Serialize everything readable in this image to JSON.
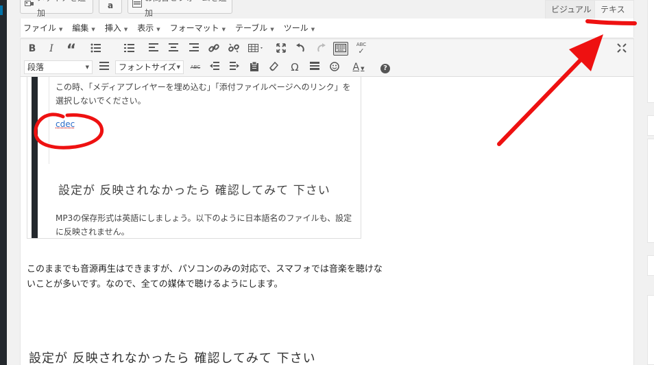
{
  "top_bar": {
    "add_media_label": "メディアを追加",
    "amazon_label": "a",
    "add_contact_form_label": "お問合せフォームを追加",
    "tab_visual": "ビジュアル",
    "tab_text": "テキスト"
  },
  "menubar": {
    "items": [
      {
        "label": "ファイル"
      },
      {
        "label": "編集"
      },
      {
        "label": "挿入"
      },
      {
        "label": "表示"
      },
      {
        "label": "フォーマット"
      },
      {
        "label": "テーブル"
      },
      {
        "label": "ツール"
      }
    ]
  },
  "toolbar": {
    "row1_icons": [
      "bold-icon",
      "italic-icon",
      "blockquote-icon",
      "bullet-list-icon",
      "numbered-list-icon",
      "align-left-icon",
      "align-center-icon",
      "align-right-icon",
      "link-icon",
      "unlink-icon",
      "table-icon",
      "fullscreen-icon",
      "undo-icon",
      "redo-icon",
      "toolbar-toggle-icon",
      "spellcheck-icon",
      "distraction-free-icon"
    ],
    "format_select": "段落",
    "font_size_select": "フォントサイズ",
    "bold": "B",
    "italic": "I",
    "quote": "“",
    "abc": "ABC",
    "omega": "Ω",
    "text_color": "A",
    "help": "?"
  },
  "editor": {
    "embed_text_1": "この時、「メディアプレイヤーを埋め込む」「添付ファイルページへのリンク」を選択しないでください。",
    "embed_link": "cdec",
    "embed_heading": "設定が 反映されなかったら 確認してみて 下さい",
    "embed_text_2": "MP3の保存形式は英語にしましょう。以下のように日本語名のファイルも、設定に反映されません。",
    "paragraph": "このままでも音源再生はできますが、パソコンのみの対応で、スマフォでは音楽を聴けないことが多いです。なので、全ての媒体で聴けるようにします。",
    "heading": "設定が 反映されなかったら 確認してみて 下さい"
  },
  "colors": {
    "annotation_red": "#ee1111",
    "link_blue": "#2a6cc8"
  }
}
